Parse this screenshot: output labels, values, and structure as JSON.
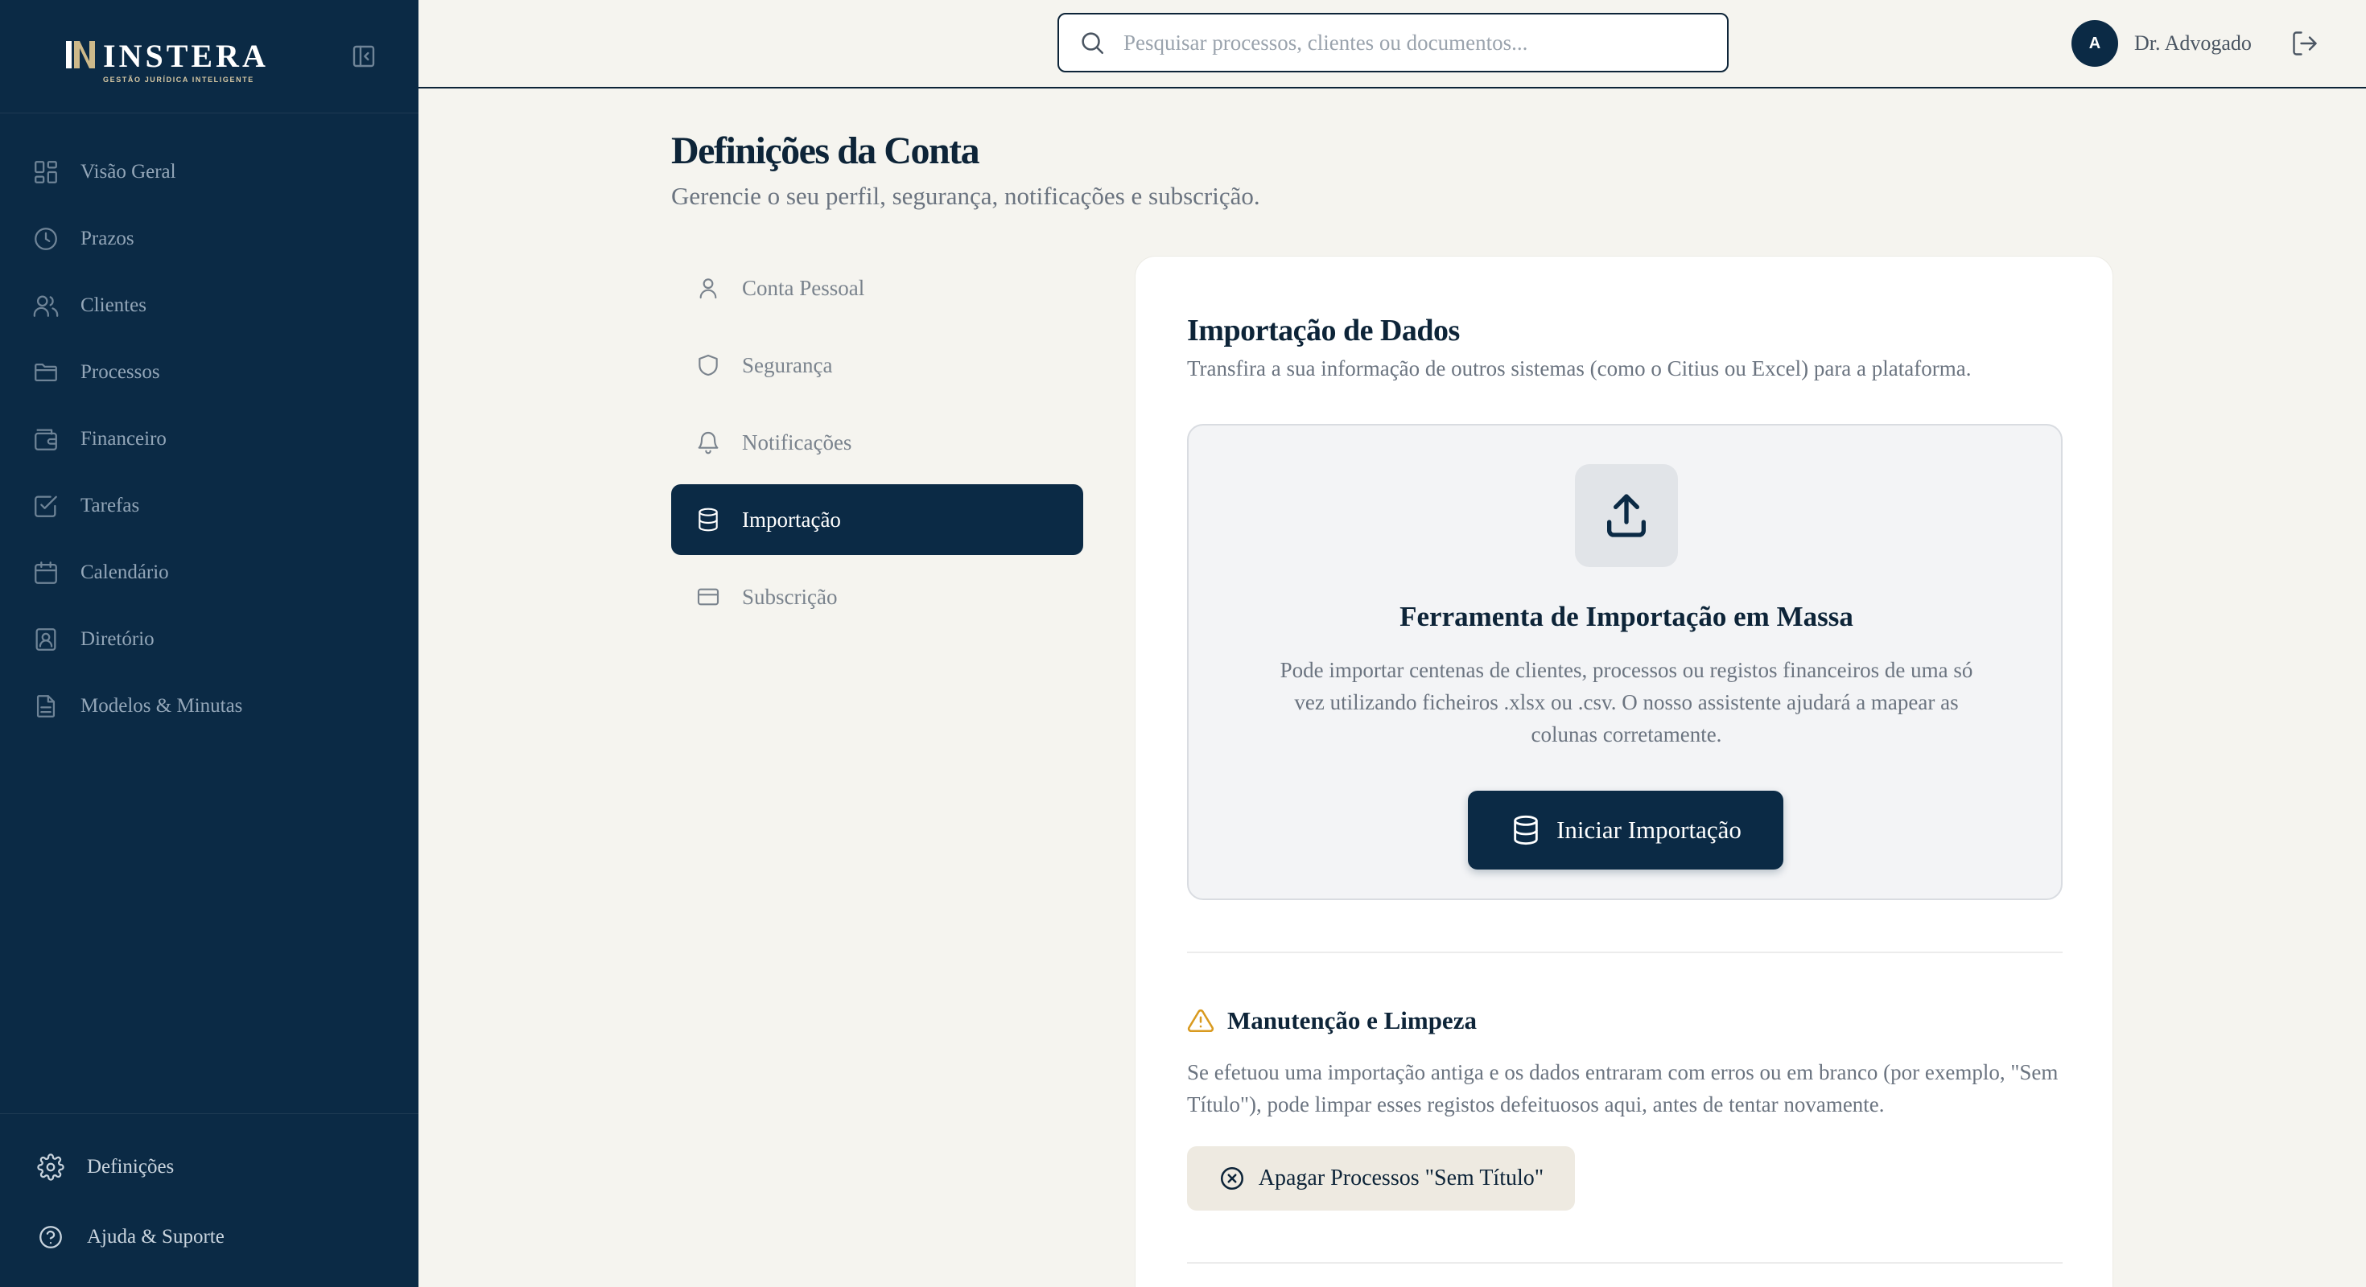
{
  "brand": {
    "name": "INSTERA",
    "tagline": "GESTÃO JURÍDICA INTELIGENTE",
    "logo_icon": "ni-monogram"
  },
  "sidebar": {
    "items": [
      {
        "label": "Visão Geral",
        "icon": "dashboard-icon"
      },
      {
        "label": "Prazos",
        "icon": "clock-icon"
      },
      {
        "label": "Clientes",
        "icon": "users-icon"
      },
      {
        "label": "Processos",
        "icon": "folder-icon"
      },
      {
        "label": "Financeiro",
        "icon": "wallet-icon"
      },
      {
        "label": "Tarefas",
        "icon": "checkbox-icon"
      },
      {
        "label": "Calendário",
        "icon": "calendar-icon"
      },
      {
        "label": "Diretório",
        "icon": "contact-book-icon"
      },
      {
        "label": "Modelos & Minutas",
        "icon": "document-icon"
      }
    ],
    "bottom": [
      {
        "label": "Definições",
        "icon": "gear-icon"
      },
      {
        "label": "Ajuda & Suporte",
        "icon": "help-icon"
      }
    ]
  },
  "topbar": {
    "search_placeholder": "Pesquisar processos, clientes ou documentos...",
    "avatar_initial": "A",
    "user_name": "Dr. Advogado"
  },
  "page": {
    "title": "Definições da Conta",
    "subtitle": "Gerencie o seu perfil, segurança, notificações e subscrição."
  },
  "tabs": [
    {
      "label": "Conta Pessoal",
      "icon": "user-icon",
      "active": false
    },
    {
      "label": "Segurança",
      "icon": "shield-icon",
      "active": false
    },
    {
      "label": "Notificações",
      "icon": "bell-icon",
      "active": false
    },
    {
      "label": "Importação",
      "icon": "database-icon",
      "active": true
    },
    {
      "label": "Subscrição",
      "icon": "credit-card-icon",
      "active": false
    }
  ],
  "import": {
    "title": "Importação de Dados",
    "description": "Transfira a sua informação de outros sistemas (como o Citius ou Excel) para a plataforma.",
    "tool_title": "Ferramenta de Importação em Massa",
    "tool_text": "Pode importar centenas de clientes, processos ou registos financeiros de uma só vez utilizando ficheiros .xlsx ou .csv. O nosso assistente ajudará a mapear as colunas corretamente.",
    "button_label": "Iniciar Importação"
  },
  "maintenance": {
    "title": "Manutenção e Limpeza",
    "text": "Se efetuou uma importação antiga e os dados entraram com erros ou em branco (por exemplo, \"Sem Título\"), pode limpar esses registos defeituosos aqui, antes de tentar novamente.",
    "button_label": "Apagar Processos \"Sem Título\"",
    "warning_color": "#d99a1f"
  },
  "colors": {
    "sidebar": "#0b2a45",
    "background": "#f5f4ef",
    "accent": "#0b2a45",
    "muted_text": "#6b7480"
  }
}
